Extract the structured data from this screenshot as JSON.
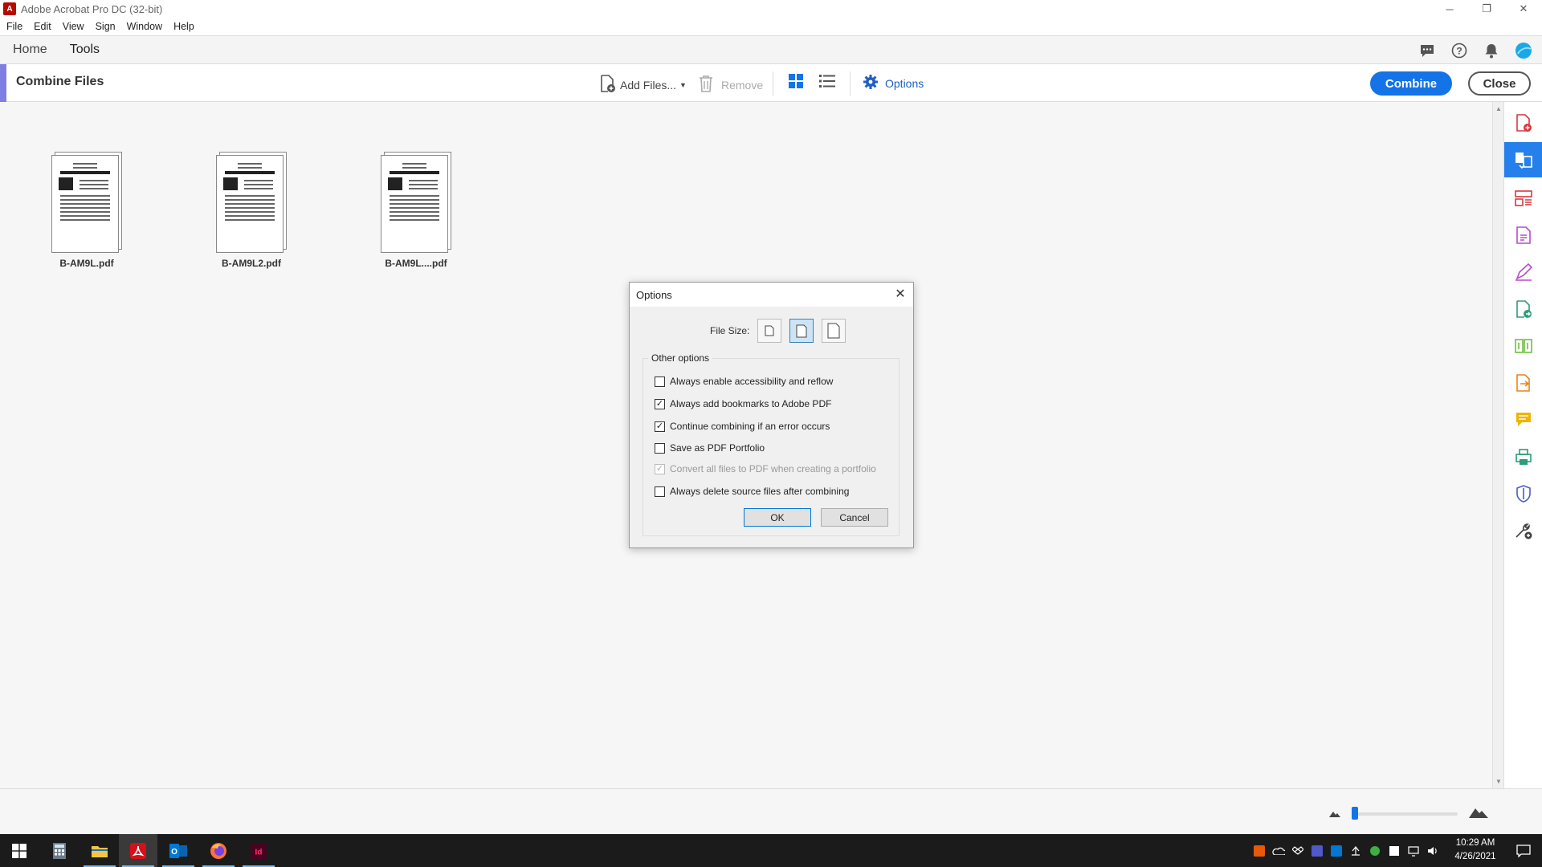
{
  "window": {
    "title": "Adobe Acrobat Pro DC (32-bit)",
    "controls": {
      "minimize": "─",
      "restore": "❐",
      "close": "✕"
    }
  },
  "menu": [
    "File",
    "Edit",
    "View",
    "Sign",
    "Window",
    "Help"
  ],
  "nav": {
    "tabs": [
      "Home",
      "Tools"
    ],
    "active_tab": "Tools",
    "icons": [
      "comment-icon",
      "help-icon",
      "bell-icon",
      "avatar"
    ]
  },
  "toolbar": {
    "title": "Combine Files",
    "add_files": "Add Files...",
    "remove": "Remove",
    "options": "Options",
    "combine": "Combine",
    "close": "Close",
    "accent_color": "#1473e6"
  },
  "files": [
    {
      "name": "B-AM9L.pdf"
    },
    {
      "name": "B-AM9L2.pdf"
    },
    {
      "name": "B-AM9L....pdf"
    }
  ],
  "dialog": {
    "title": "Options",
    "file_size_label": "File Size:",
    "file_size_selected": "medium",
    "group_label": "Other options",
    "options": [
      {
        "label": "Always enable accessibility and reflow",
        "checked": false,
        "enabled": true
      },
      {
        "label": "Always add bookmarks to Adobe PDF",
        "checked": true,
        "enabled": true
      },
      {
        "label": "Continue combining if an error occurs",
        "checked": true,
        "enabled": true
      },
      {
        "label": "Save as PDF Portfolio",
        "checked": false,
        "enabled": true
      },
      {
        "label": "Convert all files to PDF when creating a portfolio",
        "checked": true,
        "enabled": false
      },
      {
        "label": "Always delete source files after combining",
        "checked": false,
        "enabled": true
      }
    ],
    "ok": "OK",
    "cancel": "Cancel"
  },
  "zoom": {
    "level": 0.0
  },
  "taskbar": {
    "apps": [
      "start-icon",
      "calculator-icon",
      "file-explorer-icon",
      "acrobat-icon",
      "outlook-icon",
      "firefox-icon",
      "indesign-icon"
    ],
    "time": "10:29 AM",
    "date": "4/26/2021"
  }
}
